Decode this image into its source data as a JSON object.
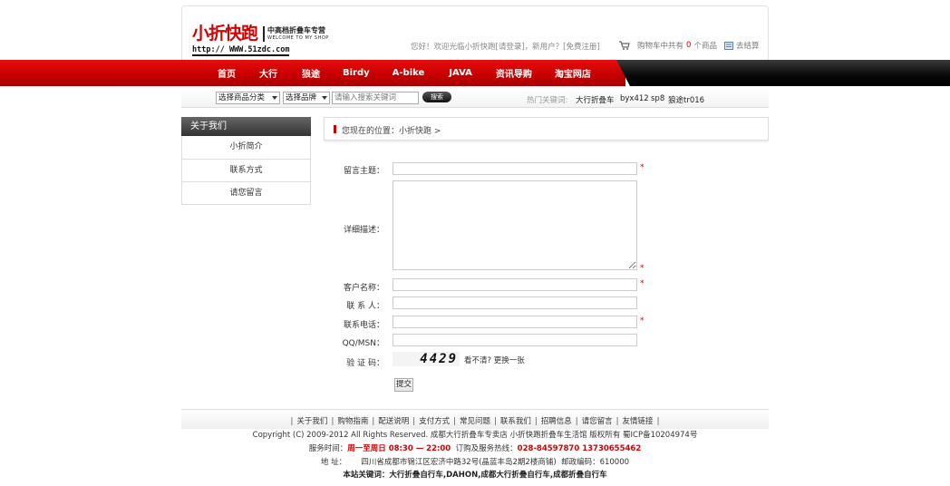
{
  "brand": {
    "name": "小折快跑",
    "slogan": "中高档折叠车专营",
    "tagline": "WELCOME TO MY SHOP",
    "url": "http:// WWW.51zdc.com"
  },
  "topbar": {
    "welcome": "您好！欢迎光临小折快跑",
    "login": "[请登录]",
    "new_user": "，新用户？",
    "register": "[免费注册]",
    "cart_prefix": "购物车中共有",
    "cart_count": "0",
    "cart_suffix": "个商品",
    "checkout": "去结算"
  },
  "nav": {
    "items": [
      {
        "label": "首页"
      },
      {
        "label": "大行"
      },
      {
        "label": "狼途"
      },
      {
        "label": "Birdy"
      },
      {
        "label": "A-bike"
      },
      {
        "label": "JAVA"
      },
      {
        "label": "资讯导购"
      },
      {
        "label": "淘宝网店"
      }
    ]
  },
  "search": {
    "category_select": "选择商品分类",
    "brand_select": "选择品牌",
    "placeholder": "请输入搜索关键词",
    "button": "搜索",
    "hot_label": "热门关键词:",
    "hot_keywords": [
      "大行折叠车",
      "byx412",
      "sp8",
      "狼途tr016"
    ]
  },
  "sidebar": {
    "title": "关于我们",
    "items": [
      {
        "label": "小折简介"
      },
      {
        "label": "联系方式"
      },
      {
        "label": "请您留言"
      }
    ]
  },
  "breadcrumb": {
    "text": "您现在的位置：小折快跑 >"
  },
  "form": {
    "subject_label": "留言主题：",
    "detail_label": "详细描述：",
    "customer_label": "客户名称：",
    "contact_label": "联 系 人：",
    "phone_label": "联系电话：",
    "qq_label": "QQ/MSN：",
    "captcha_label": "验 证 码：",
    "captcha_value": "4429",
    "captcha_refresh": "看不清? 更换一张",
    "required_mark": "*",
    "submit": "提交"
  },
  "footer": {
    "links": [
      "关于我们",
      "购物指南",
      "配送说明",
      "支付方式",
      "常见问题",
      "联系我们",
      "招聘信息",
      "请您留言",
      "友情链接"
    ],
    "copyright": "Copyright (C) 2009-2012 All Rights Reserved. 成都大行折叠车专卖店 小折快跑折叠车生活馆 版权所有  蜀ICP备10204974号",
    "hours_label": "服务时间：",
    "hours_value": "周一至周日 08:30 — 22:00",
    "hotline_label": "订购及服务热线：",
    "hotline_value": "028-84597870  13730655462",
    "address_label": "地    址：",
    "address_value": "四川省成都市锦江区宏济中路32号(晶蓝丰岛2期2楼商铺)",
    "postcode_label": "邮政编码：",
    "postcode_value": "610000",
    "keywords_label": "本站关键词：",
    "keywords_value": "大行折叠自行车,DAHON,成都大行折叠自行车,成都折叠自行车"
  },
  "colors": {
    "brand_red": "#d60000",
    "nav_red": "#c80000",
    "nav_black": "#080808"
  }
}
